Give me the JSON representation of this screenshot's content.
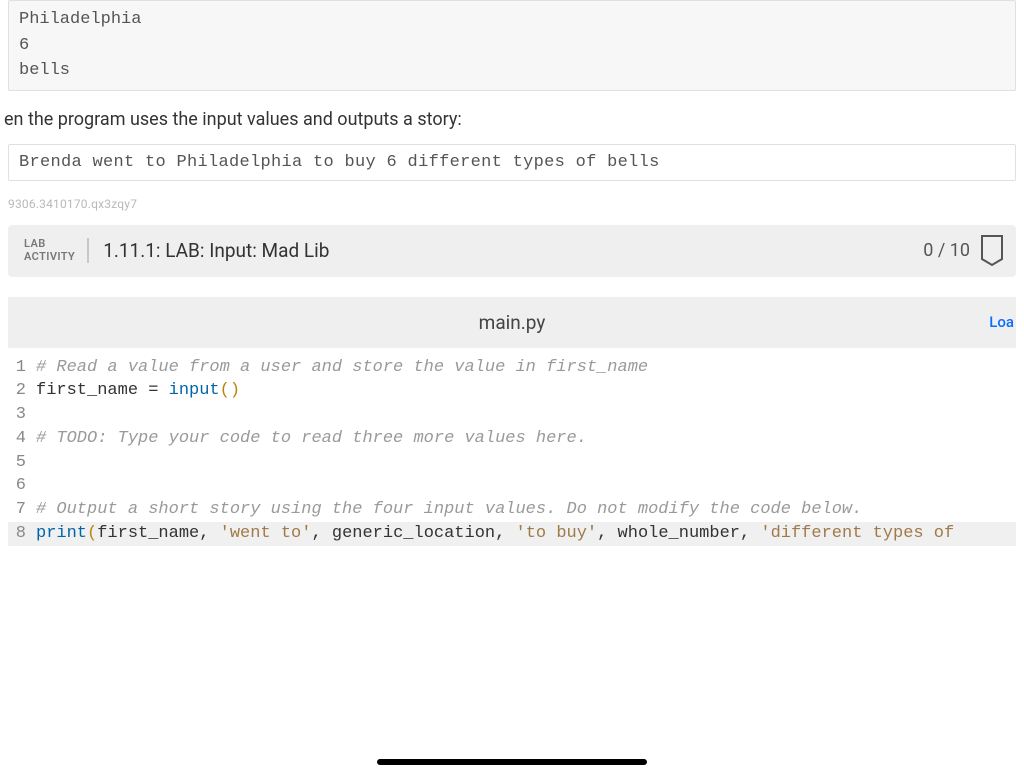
{
  "inputs": {
    "lines": [
      "Philadelphia",
      "6",
      "bells"
    ]
  },
  "prompt": "en the program uses the input values and outputs a story:",
  "output": "Brenda went to Philadelphia to buy 6 different types of bells",
  "small_id": "9306.3410170.qx3zqy7",
  "lab": {
    "label_line1": "LAB",
    "label_line2": "ACTIVITY",
    "title": "1.11.1: LAB: Input: Mad Lib",
    "score": "0 / 10"
  },
  "file": {
    "name": "main.py",
    "load": "Loa"
  },
  "code": {
    "l1_comment": "# Read a value from a user and store the value in first_name",
    "l2_var": "first_name = ",
    "l2_func": "input",
    "l2_paren": "()",
    "l4_comment": "# TODO: Type your code to read three more values here.",
    "l7_comment": "# Output a short story using the four input values. Do not modify the code below.",
    "l8_func": "print",
    "l8_lp": "(",
    "l8_a1": "first_name, ",
    "l8_s1": "'went to'",
    "l8_c1": ", ",
    "l8_a2": "generic_location, ",
    "l8_s2": "'to buy'",
    "l8_c2": ", ",
    "l8_a3": "whole_number, ",
    "l8_s3": "'different types of"
  },
  "gutter": {
    "n1": "1",
    "n2": "2",
    "n3": "3",
    "n4": "4",
    "n5": "5",
    "n6": "6",
    "n7": "7",
    "n8": "8"
  }
}
